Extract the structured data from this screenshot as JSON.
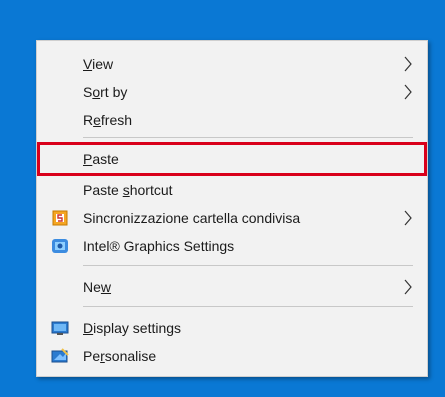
{
  "menu": {
    "items": [
      {
        "label": "View",
        "underline_index": 0,
        "has_submenu": true
      },
      {
        "label": "Sort by",
        "underline_index": 1,
        "has_submenu": true
      },
      {
        "label": "Refresh",
        "underline_index": 1,
        "has_submenu": false
      },
      {
        "label": "Paste",
        "underline_index": 0,
        "has_submenu": false,
        "highlighted": true
      },
      {
        "label": "Paste shortcut",
        "underline_index": 6,
        "has_submenu": false
      },
      {
        "label": "Sincronizzazione cartella condivisa",
        "icon": "sync-folder-icon",
        "has_submenu": true
      },
      {
        "label": "Intel® Graphics Settings",
        "icon": "intel-graphics-icon",
        "has_submenu": false
      },
      {
        "label": "New",
        "underline_index": 2,
        "has_submenu": true
      },
      {
        "label": "Display settings",
        "underline_index": 0,
        "icon": "display-settings-icon",
        "has_submenu": false
      },
      {
        "label": "Personalise",
        "underline_index": 2,
        "icon": "personalise-icon",
        "has_submenu": false
      }
    ]
  },
  "colors": {
    "desktop": "#0a78d4",
    "menu_bg": "#f2f2f2",
    "highlight_border": "#d9001b"
  }
}
